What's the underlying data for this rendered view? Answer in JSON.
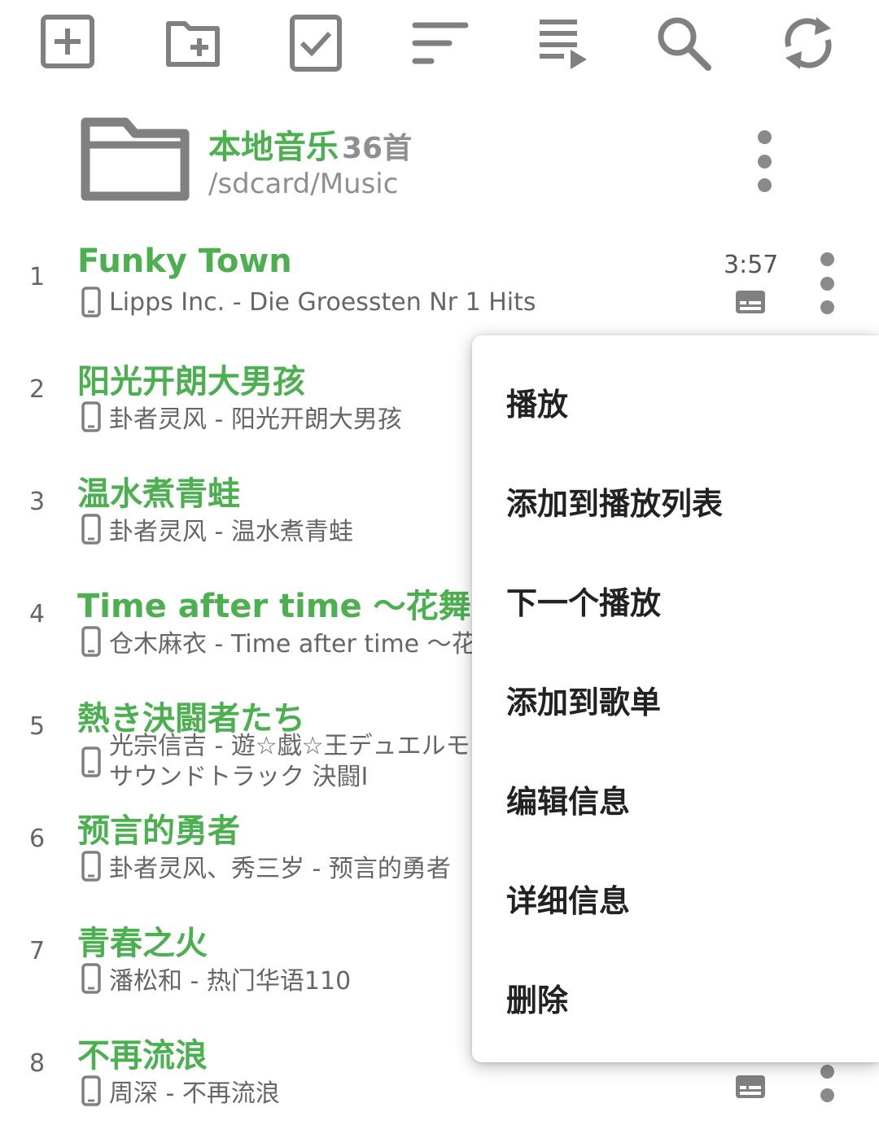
{
  "toolbar": {
    "icons": [
      "add-box-icon",
      "create-folder-icon",
      "checkbox-icon",
      "sort-icon",
      "playlist-play-icon",
      "search-icon",
      "refresh-icon"
    ]
  },
  "colors": {
    "accent": "#4caf50",
    "icon": "#808080",
    "secondary_text": "#666666"
  },
  "folder": {
    "title": "本地音乐",
    "count": "36首",
    "path": "/sdcard/Music"
  },
  "songs": [
    {
      "index": "1",
      "title": "Funky Town",
      "subtitle": "Lipps Inc. - Die Groessten Nr 1 Hits",
      "duration": "3:57"
    },
    {
      "index": "2",
      "title": "阳光开朗大男孩",
      "subtitle": "卦者灵风 - 阳光开朗大男孩"
    },
    {
      "index": "3",
      "title": "温水煮青蛙",
      "subtitle": "卦者灵风 - 温水煮青蛙"
    },
    {
      "index": "4",
      "title": "Time after time ～花舞う街で～",
      "subtitle": "仓木麻衣 - Time after time ～花舞う街で～"
    },
    {
      "index": "5",
      "title": "熱き決闘者たち",
      "subtitle_line1": "光宗信吉 - 遊☆戯☆王デュエルモンスターズ",
      "subtitle_line2": "サウンドトラック 決闘Ⅰ"
    },
    {
      "index": "6",
      "title": "预言的勇者",
      "subtitle": "卦者灵风、秀三岁 - 预言的勇者"
    },
    {
      "index": "7",
      "title": "青春之火",
      "subtitle": "潘松和 - 热门华语110"
    },
    {
      "index": "8",
      "title": "不再流浪",
      "subtitle": "周深 - 不再流浪"
    }
  ],
  "context_menu": {
    "items": [
      "播放",
      "添加到播放列表",
      "下一个播放",
      "添加到歌单",
      "编辑信息",
      "详细信息",
      "删除"
    ]
  }
}
